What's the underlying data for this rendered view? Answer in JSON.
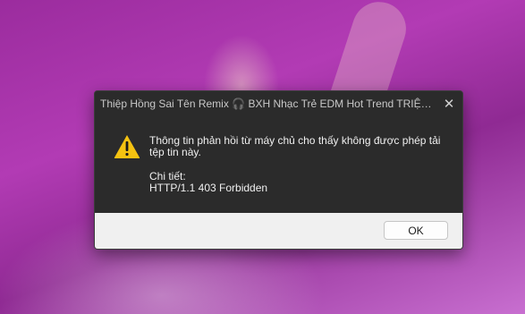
{
  "dialog": {
    "title": "Thiệp Hồng Sai Tên Remix 🎧 BXH Nhạc Trẻ EDM Hot Trend TRIỆU VIE...",
    "close_glyph": "✕",
    "icon": "warning-icon",
    "message": "Thông tin phản hồi từ máy chủ cho thấy không được phép tải tệp tin này.",
    "details_label": "Chi tiết:",
    "details_value": "HTTP/1.1 403 Forbidden",
    "ok_label": "OK"
  },
  "colors": {
    "warning_yellow": "#f5c211",
    "dialog_bg": "#2b2b2b",
    "footer_bg": "#f0f0f0"
  }
}
